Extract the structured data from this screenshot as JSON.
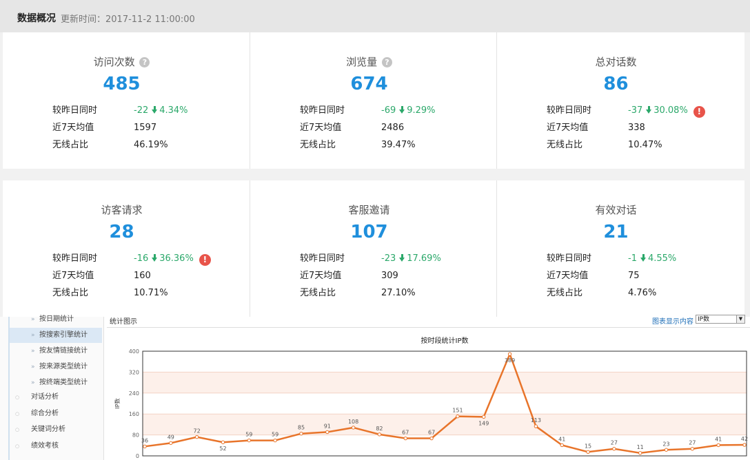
{
  "header": {
    "title": "数据概况",
    "update": "更新时间：2017-11-2 11:00:00"
  },
  "row_labels": {
    "compare": "较昨日同时",
    "avg7": "近7天均值",
    "wireless": "无线占比"
  },
  "metrics": [
    {
      "title": "访问次数",
      "help": "?",
      "value": "485",
      "diff": "-22",
      "pct": "4.34%",
      "avg": "1597",
      "wireless": "46.19%",
      "warn": false
    },
    {
      "title": "浏览量",
      "help": "?",
      "value": "674",
      "diff": "-69",
      "pct": "9.29%",
      "avg": "2486",
      "wireless": "39.47%",
      "warn": false
    },
    {
      "title": "总对话数",
      "value": "86",
      "diff": "-37",
      "pct": "30.08%",
      "avg": "338",
      "wireless": "10.47%",
      "warn": true
    },
    {
      "title": "访客请求",
      "value": "28",
      "diff": "-16",
      "pct": "36.36%",
      "avg": "160",
      "wireless": "10.71%",
      "warn": true
    },
    {
      "title": "客服邀请",
      "value": "107",
      "diff": "-23",
      "pct": "17.69%",
      "avg": "309",
      "wireless": "27.10%",
      "warn": false
    },
    {
      "title": "有效对话",
      "value": "21",
      "diff": "-1",
      "pct": "4.55%",
      "avg": "75",
      "wireless": "4.76%",
      "warn": false
    }
  ],
  "warn_glyph": "!",
  "sidebar": {
    "items": [
      {
        "label": "按日期统计",
        "type": "sub"
      },
      {
        "label": "按搜索引擎统计",
        "type": "sub",
        "active": true
      },
      {
        "label": "按友情链接统计",
        "type": "sub"
      },
      {
        "label": "按来源类型统计",
        "type": "sub"
      },
      {
        "label": "按终端类型统计",
        "type": "sub"
      },
      {
        "label": "对话分析",
        "type": "top"
      },
      {
        "label": "综合分析",
        "type": "top"
      },
      {
        "label": "关键词分析",
        "type": "top"
      },
      {
        "label": "绩效考核",
        "type": "top"
      }
    ]
  },
  "chart_panel": {
    "title": "统计图示",
    "option_label": "图表显示内容",
    "select_value": "IP数",
    "dropdown_glyph": "▼"
  },
  "chart_data": {
    "type": "line",
    "title": "按时段统计IP数",
    "ylabel": "IP数",
    "ylim": [
      0,
      400
    ],
    "yticks": [
      0,
      80,
      160,
      240,
      320,
      400
    ],
    "series": [
      {
        "values": [
          36,
          49,
          72,
          52,
          59,
          59,
          85,
          91,
          108,
          82,
          67,
          67,
          151,
          149,
          389,
          113,
          41,
          15,
          27,
          11,
          23,
          27,
          41,
          42
        ]
      }
    ],
    "colors": {
      "line": "#e8742a",
      "band": "#fdf0ea",
      "frame": "#333333"
    }
  }
}
